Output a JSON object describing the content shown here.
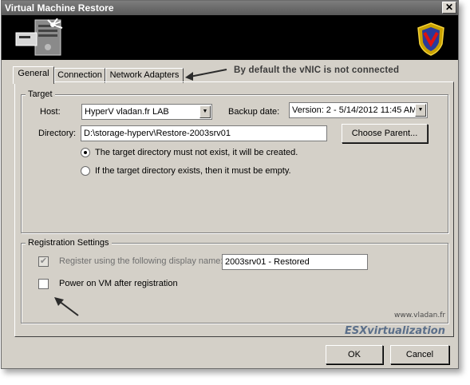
{
  "window": {
    "title": "Virtual Machine Restore",
    "close_glyph": "✕"
  },
  "banner": {
    "left_icon": "server-disk-icon",
    "right_icon": "veeam-shield-logo-icon"
  },
  "tabs": [
    {
      "label": "General",
      "active": true
    },
    {
      "label": "Connection",
      "active": false
    },
    {
      "label": "Network Adapters",
      "active": false
    }
  ],
  "annotation": {
    "text": "By default the vNIC is not connected"
  },
  "target": {
    "legend": "Target",
    "host_label": "Host:",
    "host_value": "HyperV vladan.fr LAB",
    "backup_date_label": "Backup date:",
    "backup_date_value": "Version: 2 - 5/14/2012 11:45 AM",
    "directory_label": "Directory:",
    "directory_value": "D:\\storage-hyperv\\Restore-2003srv01",
    "choose_parent_label": "Choose Parent...",
    "radio_options": [
      {
        "label": "The target directory must not exist, it will be created.",
        "selected": true
      },
      {
        "label": "If the target directory exists, then it must be empty.",
        "selected": false
      }
    ]
  },
  "registration": {
    "legend": "Registration Settings",
    "register_label": "Register using the following display name:",
    "register_checked": true,
    "display_name_value": "2003srv01 - Restored",
    "power_on_label": "Power on VM after registration",
    "power_on_checked": false
  },
  "watermark": {
    "site": "www.vladan.fr",
    "brand": "ESXvirtualization"
  },
  "footer": {
    "ok_label": "OK",
    "cancel_label": "Cancel"
  },
  "colors": {
    "window_bg": "#d4d0c8",
    "title_bar": "#6a6a6a",
    "banner": "#000000"
  }
}
